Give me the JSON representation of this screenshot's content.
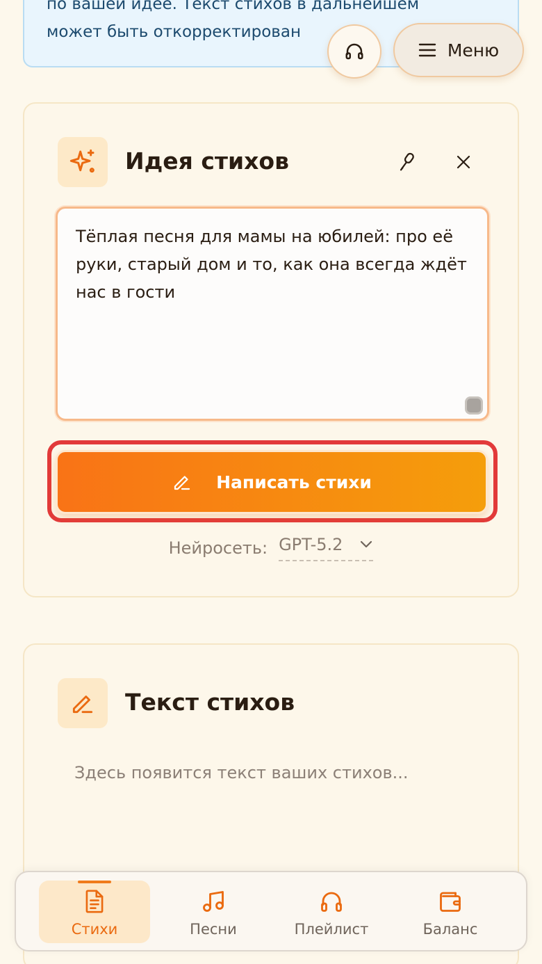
{
  "info": {
    "line1": "по вашей идее. Текст стихов в дальнейшем",
    "line2": "может быть откорректирован"
  },
  "header": {
    "menu_label": "Меню"
  },
  "idea_card": {
    "title": "Идея стихов",
    "textarea_value": "Тёплая песня для мамы на юбилей: про её руки, старый дом и то, как она всегда ждёт нас в гости",
    "submit_label": "Написать стихи",
    "model_label": "Нейросеть:",
    "model_value": "GPT-5.2"
  },
  "text_card": {
    "title": "Текст стихов",
    "placeholder": "Здесь появится текст ваших стихов..."
  },
  "nav": {
    "items": [
      {
        "label": "Стихи",
        "icon": "document-icon",
        "active": true
      },
      {
        "label": "Песни",
        "icon": "music-note-icon",
        "active": false
      },
      {
        "label": "Плейлист",
        "icon": "headphones-icon",
        "active": false
      },
      {
        "label": "Баланс",
        "icon": "wallet-icon",
        "active": false
      }
    ]
  },
  "colors": {
    "accent": "#f97316",
    "accent_end": "#f59e0b",
    "highlight_outline": "#e23a3a",
    "background": "#fdf8ec"
  }
}
